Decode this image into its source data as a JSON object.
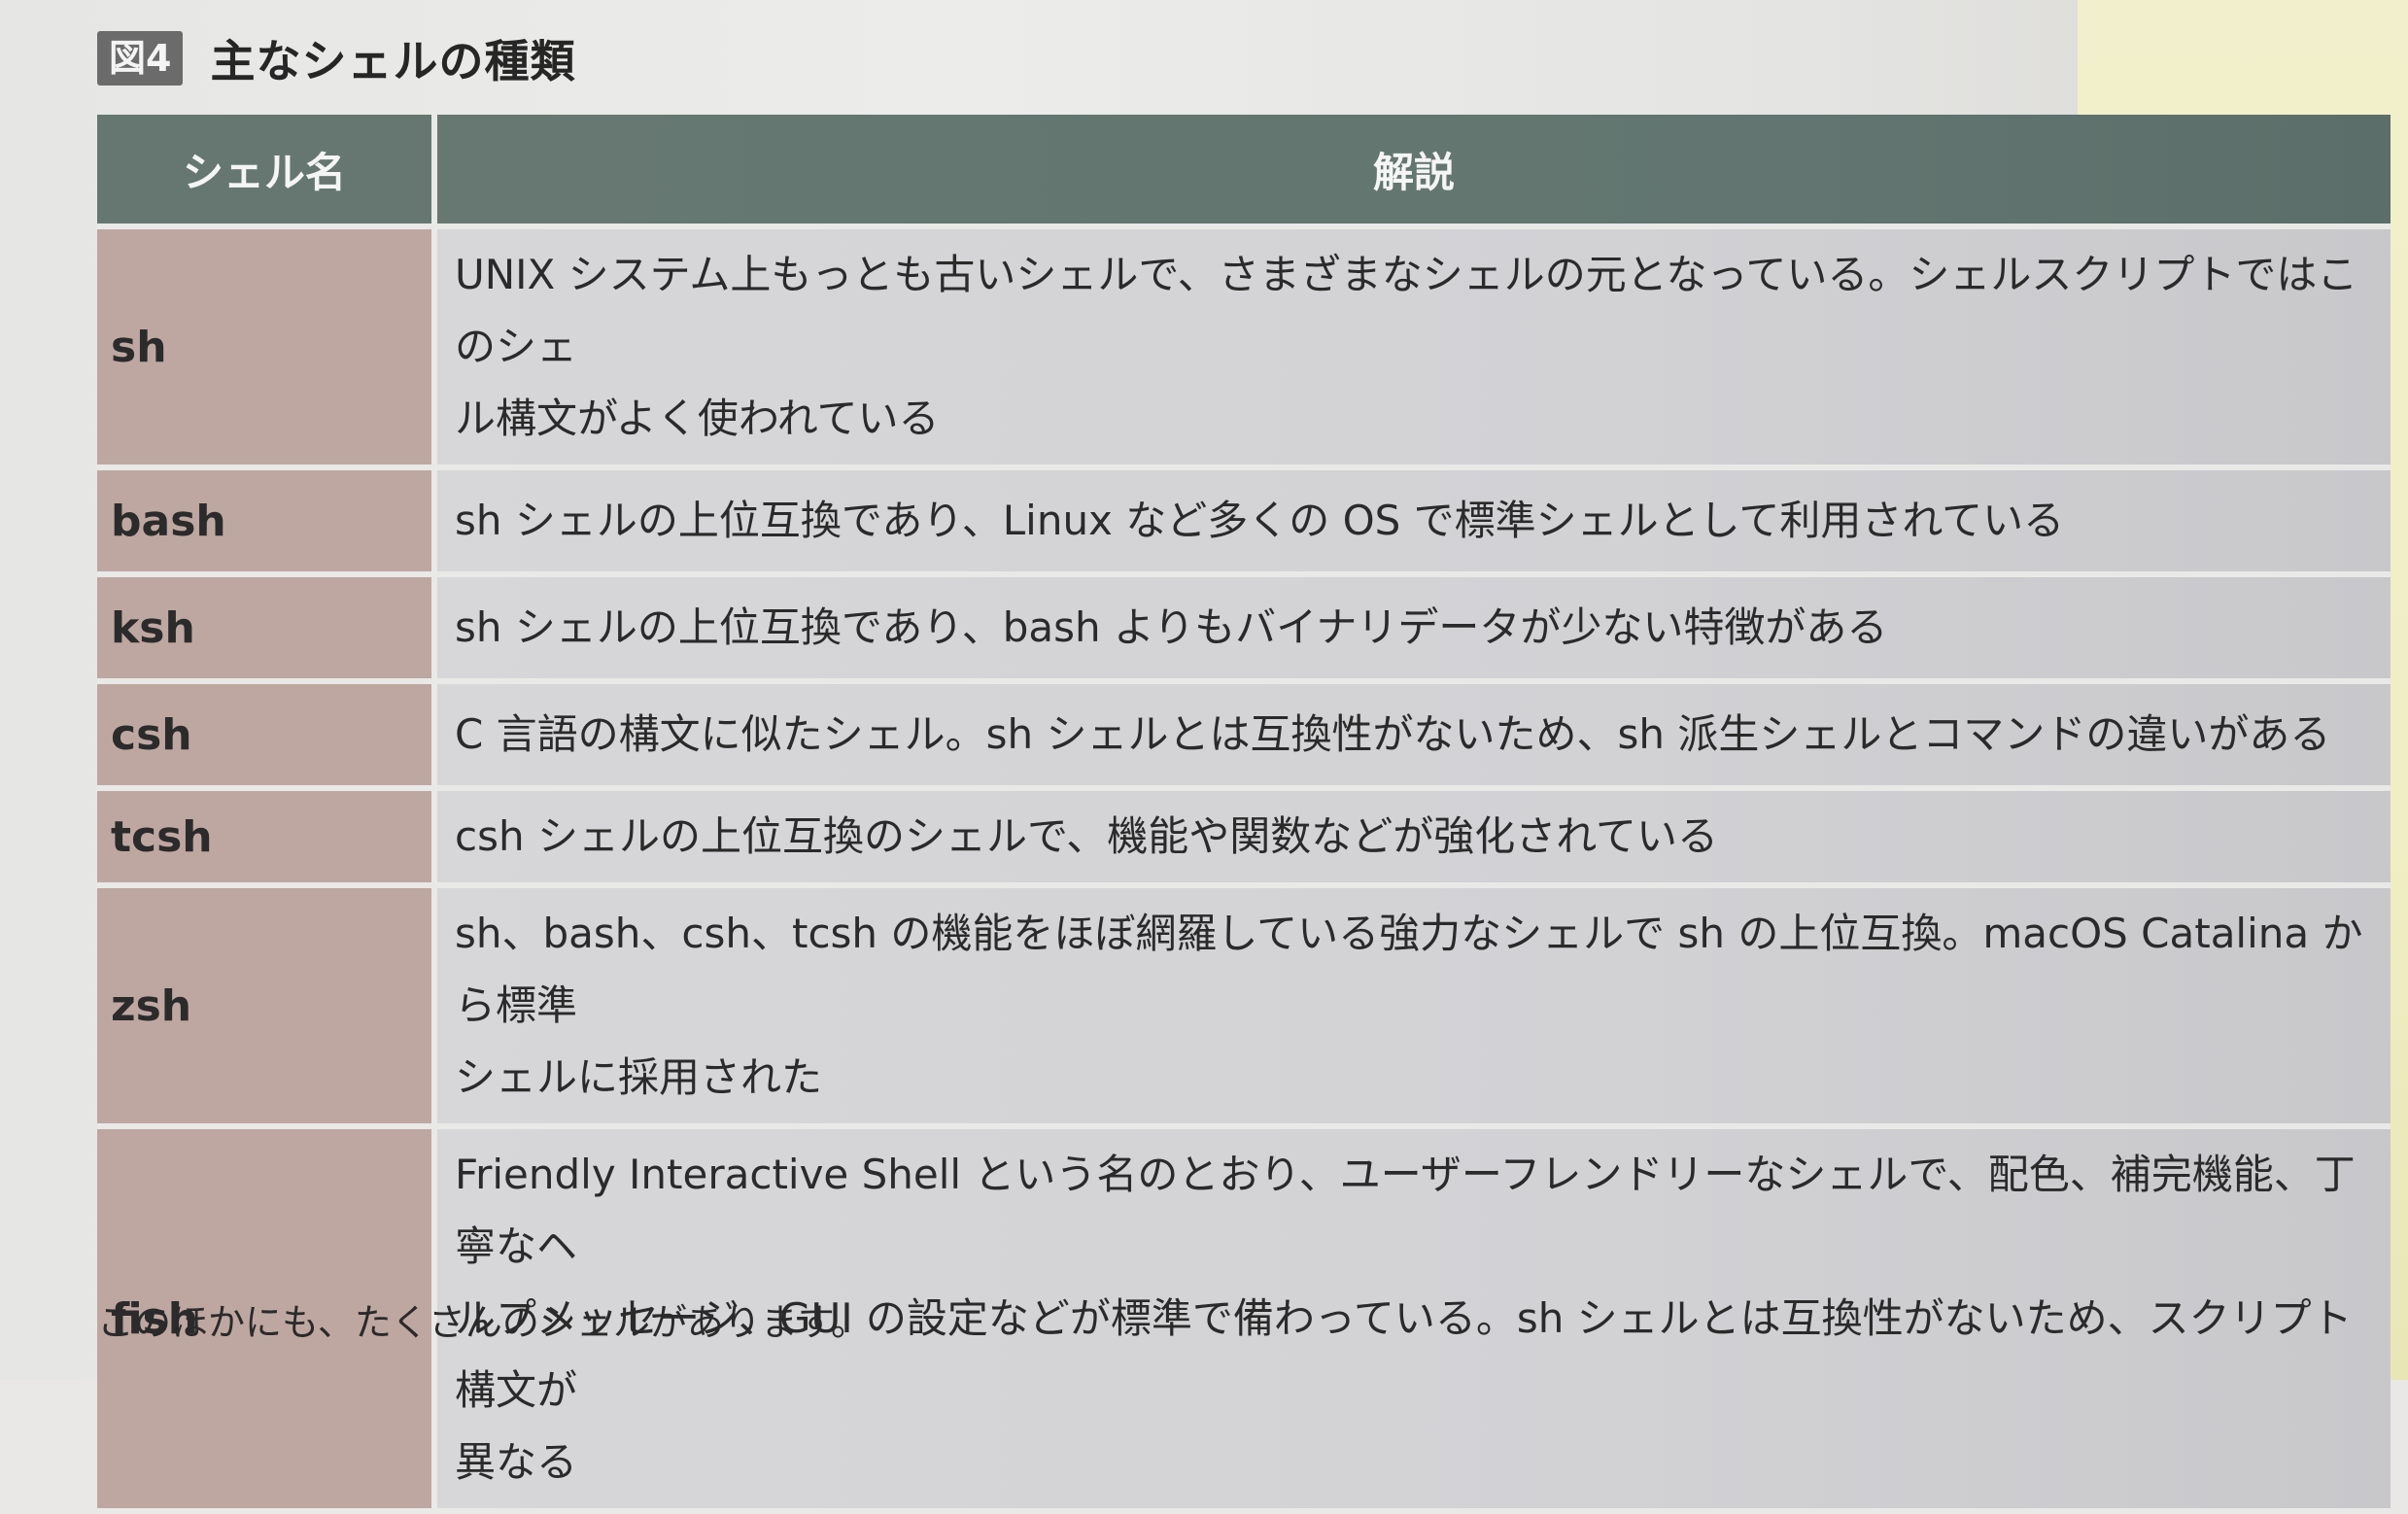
{
  "figure": {
    "label": "図4",
    "title": "主なシェルの種類"
  },
  "table": {
    "headers": [
      "シェル名",
      "解説"
    ],
    "rows": [
      {
        "name": "sh",
        "description": "UNIX システム上もっとも古いシェルで、さまざまなシェルの元となっている。シェルスクリプトではこのシェ\nル構文がよく使われている"
      },
      {
        "name": "bash",
        "description": "sh シェルの上位互換であり、Linux など多くの OS で標準シェルとして利用されている"
      },
      {
        "name": "ksh",
        "description": "sh シェルの上位互換であり、bash よりもバイナリデータが少ない特徴がある"
      },
      {
        "name": "csh",
        "description": "C 言語の構文に似たシェル。sh シェルとは互換性がないため、sh 派生シェルとコマンドの違いがある"
      },
      {
        "name": "tcsh",
        "description": "csh シェルの上位互換のシェルで、機能や関数などが強化されている"
      },
      {
        "name": "zsh",
        "description": "sh、bash、csh、tcsh の機能をほぼ網羅している強力なシェルで sh の上位互換。macOS Catalina から標準\nシェルに採用された"
      },
      {
        "name": "fish",
        "description": "Friendly Interactive Shell という名のとおり、ユーザーフレンドリーなシェルで、配色、補完機能、丁寧なヘ\nルプメッセージ、GUI の設定などが標準で備わっている。sh シェルとは互換性がないため、スクリプト構文が\n異なる"
      }
    ]
  },
  "note": "このほかにも、たくさんのシェルがあります。"
}
